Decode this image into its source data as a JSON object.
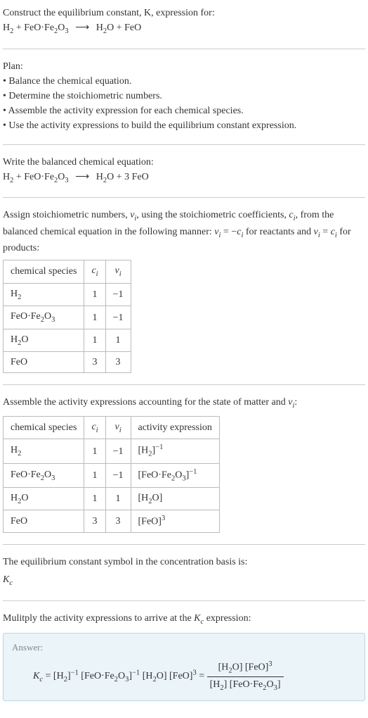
{
  "intro": {
    "line1": "Construct the equilibrium constant, K, expression for:",
    "equation": "H₂ + FeO·Fe₂O₃ ⟶ H₂O + FeO"
  },
  "plan": {
    "heading": "Plan:",
    "items": [
      "Balance the chemical equation.",
      "Determine the stoichiometric numbers.",
      "Assemble the activity expression for each chemical species.",
      "Use the activity expressions to build the equilibrium constant expression."
    ]
  },
  "balanced": {
    "heading": "Write the balanced chemical equation:",
    "equation": "H₂ + FeO·Fe₂O₃ ⟶ H₂O + 3 FeO"
  },
  "stoich": {
    "heading_a": "Assign stoichiometric numbers, νᵢ, using the stoichiometric coefficients, cᵢ, from the balanced chemical equation in the following manner: νᵢ = −cᵢ for reactants and νᵢ = cᵢ for products:",
    "headers": {
      "col1": "chemical species",
      "col2": "cᵢ",
      "col3": "νᵢ"
    },
    "rows": [
      {
        "species": "H₂",
        "ci": "1",
        "vi": "−1"
      },
      {
        "species": "FeO·Fe₂O₃",
        "ci": "1",
        "vi": "−1"
      },
      {
        "species": "H₂O",
        "ci": "1",
        "vi": "1"
      },
      {
        "species": "FeO",
        "ci": "3",
        "vi": "3"
      }
    ]
  },
  "activity": {
    "heading": "Assemble the activity expressions accounting for the state of matter and νᵢ:",
    "headers": {
      "col1": "chemical species",
      "col2": "cᵢ",
      "col3": "νᵢ",
      "col4": "activity expression"
    },
    "rows": [
      {
        "species": "H₂",
        "ci": "1",
        "vi": "−1",
        "expr": "[H₂]⁻¹"
      },
      {
        "species": "FeO·Fe₂O₃",
        "ci": "1",
        "vi": "−1",
        "expr": "[FeO·Fe₂O₃]⁻¹"
      },
      {
        "species": "H₂O",
        "ci": "1",
        "vi": "1",
        "expr": "[H₂O]"
      },
      {
        "species": "FeO",
        "ci": "3",
        "vi": "3",
        "expr": "[FeO]³"
      }
    ]
  },
  "symbol": {
    "line1": "The equilibrium constant symbol in the concentration basis is:",
    "symbol": "K꜀"
  },
  "multiply": {
    "heading": "Mulitply the activity expressions to arrive at the K꜀ expression:"
  },
  "answer": {
    "label": "Answer:",
    "lhs": "K꜀ = [H₂]⁻¹ [FeO·Fe₂O₃]⁻¹ [H₂O] [FeO]³ = ",
    "frac_num": "[H₂O] [FeO]³",
    "frac_den": "[H₂] [FeO·Fe₂O₃]"
  },
  "chart_data": {
    "type": "table",
    "tables": [
      {
        "name": "stoichiometric_numbers",
        "columns": [
          "chemical species",
          "cᵢ",
          "νᵢ"
        ],
        "rows": [
          [
            "H₂",
            1,
            -1
          ],
          [
            "FeO·Fe₂O₃",
            1,
            -1
          ],
          [
            "H₂O",
            1,
            1
          ],
          [
            "FeO",
            3,
            3
          ]
        ]
      },
      {
        "name": "activity_expressions",
        "columns": [
          "chemical species",
          "cᵢ",
          "νᵢ",
          "activity expression"
        ],
        "rows": [
          [
            "H₂",
            1,
            -1,
            "[H₂]^(-1)"
          ],
          [
            "FeO·Fe₂O₃",
            1,
            -1,
            "[FeO·Fe₂O₃]^(-1)"
          ],
          [
            "H₂O",
            1,
            1,
            "[H₂O]"
          ],
          [
            "FeO",
            3,
            3,
            "[FeO]^3"
          ]
        ]
      }
    ]
  }
}
